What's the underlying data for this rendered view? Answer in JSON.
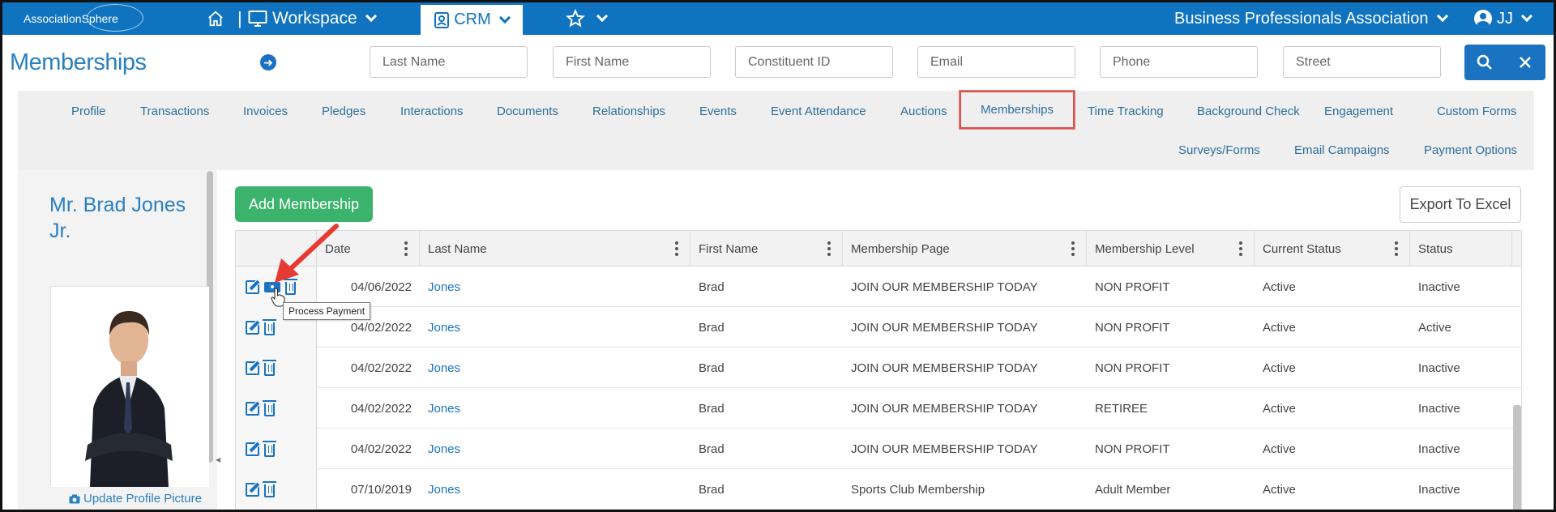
{
  "topbar": {
    "logo_text": "AssociationSphere",
    "workspace_label": "Workspace",
    "crm_label": "CRM",
    "org_name": "Business Professionals Association",
    "user_initials": "JJ",
    "brand_color": "#0f73bf"
  },
  "header": {
    "page_title": "Memberships",
    "search_fields": [
      {
        "placeholder": "Last Name"
      },
      {
        "placeholder": "First Name"
      },
      {
        "placeholder": "Constituent ID"
      },
      {
        "placeholder": "Email"
      },
      {
        "placeholder": "Phone"
      },
      {
        "placeholder": "Street"
      }
    ]
  },
  "tabs": {
    "row1": [
      "Profile",
      "Transactions",
      "Invoices",
      "Pledges",
      "Interactions",
      "Documents",
      "Relationships",
      "Events",
      "Event Attendance",
      "Auctions",
      "Memberships",
      "Time Tracking",
      "Background Check",
      "Engagement",
      "Custom Forms"
    ],
    "row2": [
      "Surveys/Forms",
      "Email Campaigns",
      "Payment Options"
    ],
    "active": "Memberships"
  },
  "profile": {
    "name": "Mr. Brad Jones Jr.",
    "update_picture_label": "Update Profile Picture"
  },
  "actions": {
    "add_label": "Add Membership",
    "export_label": "Export To Excel",
    "tooltip": "Process Payment"
  },
  "table": {
    "columns": [
      "Date",
      "Last Name",
      "First Name",
      "Membership Page",
      "Membership Level",
      "Current Status",
      "Status"
    ],
    "rows": [
      {
        "date": "04/06/2022",
        "last": "Jones",
        "first": "Brad",
        "page": "JOIN OUR MEMBERSHIP TODAY",
        "level": "NON PROFIT",
        "current": "Active",
        "status": "Inactive"
      },
      {
        "date": "04/02/2022",
        "last": "Jones",
        "first": "Brad",
        "page": "JOIN OUR MEMBERSHIP TODAY",
        "level": "NON PROFIT",
        "current": "Active",
        "status": "Active"
      },
      {
        "date": "04/02/2022",
        "last": "Jones",
        "first": "Brad",
        "page": "JOIN OUR MEMBERSHIP TODAY",
        "level": "NON PROFIT",
        "current": "Active",
        "status": "Inactive"
      },
      {
        "date": "04/02/2022",
        "last": "Jones",
        "first": "Brad",
        "page": "JOIN OUR MEMBERSHIP TODAY",
        "level": "RETIREE",
        "current": "Active",
        "status": "Inactive"
      },
      {
        "date": "04/02/2022",
        "last": "Jones",
        "first": "Brad",
        "page": "JOIN OUR MEMBERSHIP TODAY",
        "level": "NON PROFIT",
        "current": "Active",
        "status": "Inactive"
      },
      {
        "date": "07/10/2019",
        "last": "Jones",
        "first": "Brad",
        "page": "Sports Club Membership",
        "level": "Adult Member",
        "current": "Active",
        "status": "Inactive"
      }
    ]
  }
}
